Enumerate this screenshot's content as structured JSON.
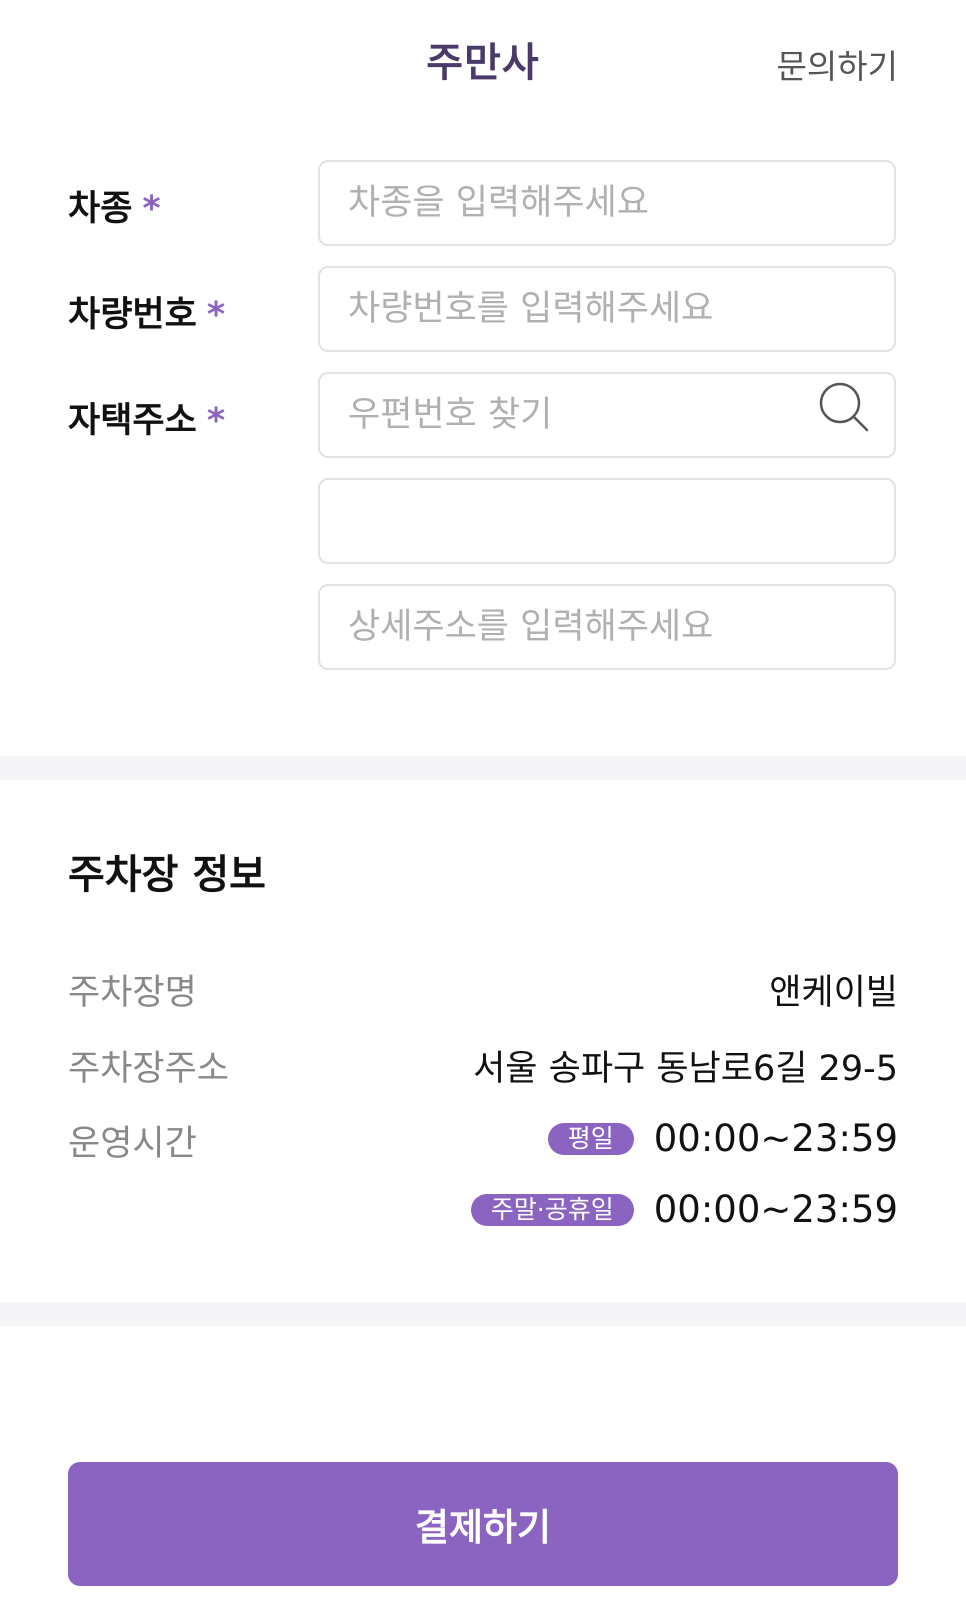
{
  "header": {
    "title": "주만사",
    "inquiry_label": "문의하기"
  },
  "form": {
    "car_model": {
      "label": "차종",
      "required_mark": "*",
      "placeholder": "차종을 입력해주세요"
    },
    "car_number": {
      "label": "차량번호",
      "required_mark": "*",
      "placeholder": "차량번호를 입력해주세요"
    },
    "home_address": {
      "label": "자택주소",
      "required_mark": "*",
      "zipcode_placeholder": "우편번호 찾기",
      "address_value": "",
      "detail_placeholder": "상세주소를 입력해주세요",
      "search_icon": "search-icon"
    }
  },
  "parking_info": {
    "section_title": "주차장 정보",
    "name_label": "주차장명",
    "name_value": "앤케이빌",
    "address_label": "주차장주소",
    "address_value": "서울 송파구 동남로6길 29-5",
    "hours_label": "운영시간",
    "weekday_badge": "평일",
    "weekday_hours": "00:00~23:59",
    "weekend_badge": "주말·공휴일",
    "weekend_hours": "00:00~23:59"
  },
  "pay_button_label": "결제하기",
  "colors": {
    "accent": "#8b63c0",
    "header_title": "#4a3a6a",
    "divider": "#f5f5f7",
    "input_border": "#e2e2e2",
    "placeholder": "#b0b0b0",
    "label_gray": "#888888"
  }
}
